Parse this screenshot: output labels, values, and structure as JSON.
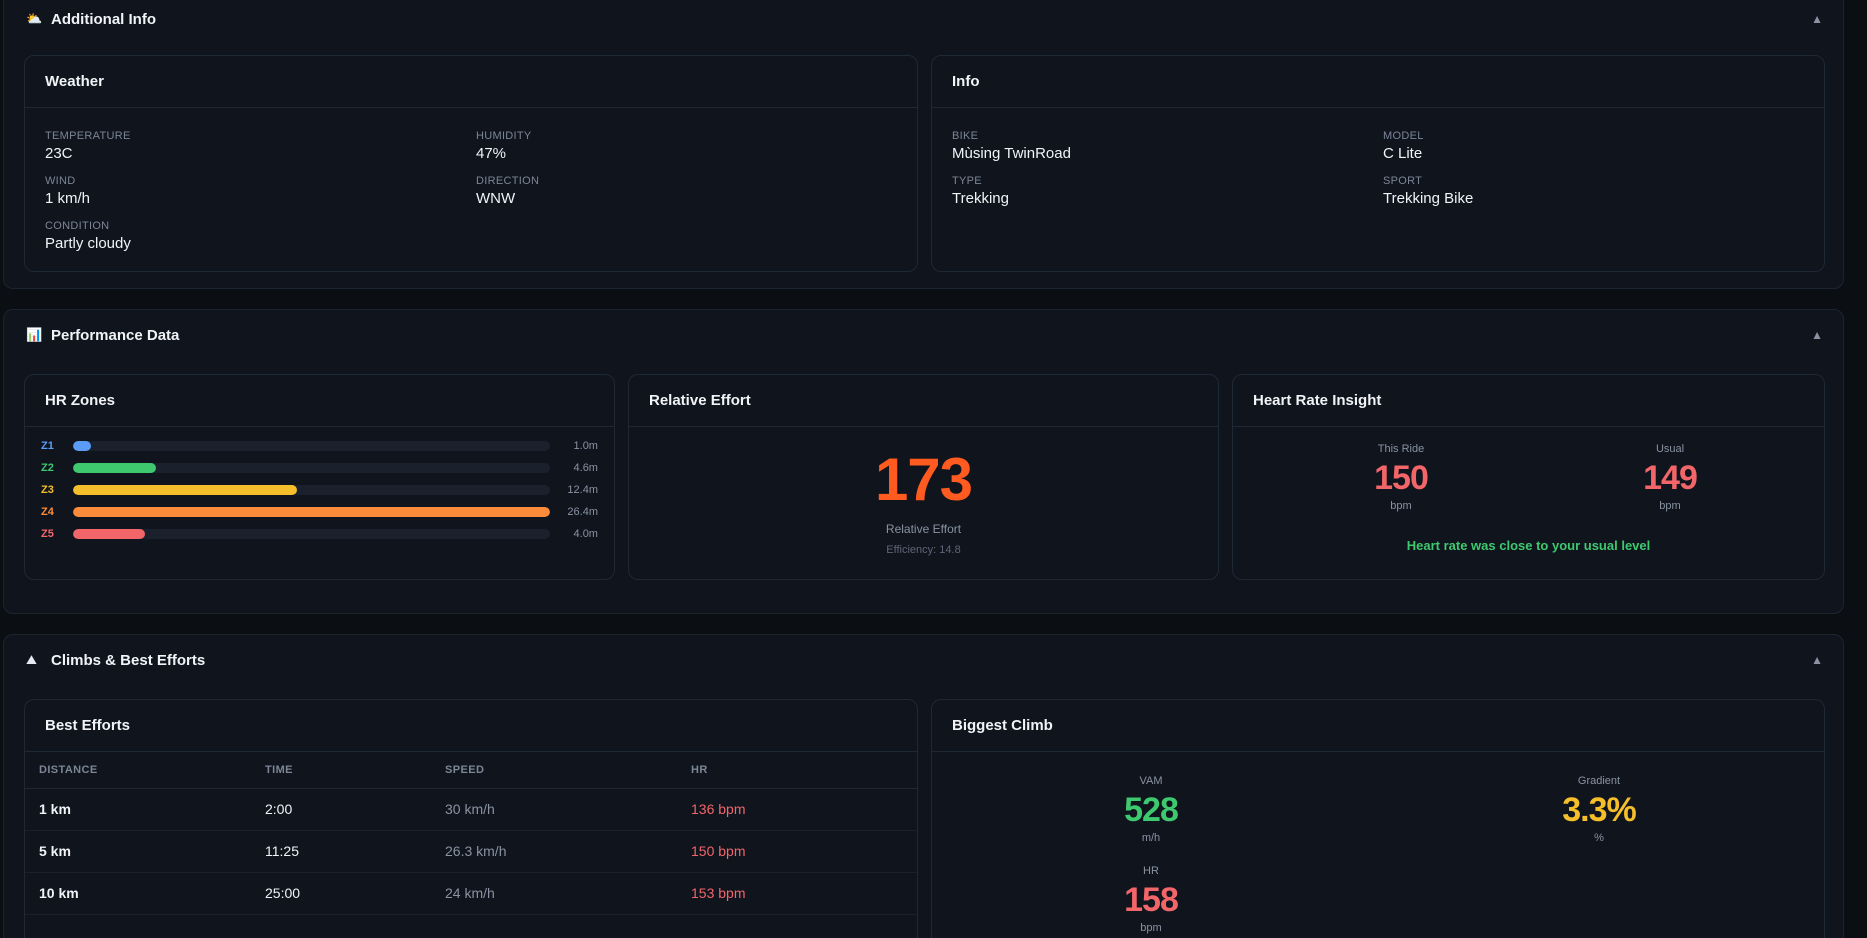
{
  "additional": {
    "title": "Additional Info",
    "toggle": "▲",
    "weather": {
      "title": "Weather",
      "temperature_label": "TEMPERATURE",
      "temperature": "23C",
      "humidity_label": "HUMIDITY",
      "humidity": "47%",
      "wind_label": "WIND",
      "wind": "1 km/h",
      "direction_label": "DIRECTION",
      "direction": "WNW",
      "condition_label": "CONDITION",
      "condition": "Partly cloudy"
    },
    "info": {
      "title": "Info",
      "bike_label": "BIKE",
      "bike": "Mùsing TwinRoad",
      "model_label": "MODEL",
      "model": "C Lite",
      "type_label": "TYPE",
      "type": "Trekking",
      "sport_label": "SPORT",
      "sport": "Trekking Bike"
    }
  },
  "performance": {
    "title": "Performance Data",
    "toggle": "▲",
    "hr_zones": {
      "title": "HR Zones",
      "zones": [
        {
          "label": "Z1",
          "value": "1.0m",
          "fraction": 0.038,
          "color": "#5b9cf6"
        },
        {
          "label": "Z2",
          "value": "4.6m",
          "fraction": 0.174,
          "color": "#3ec96f"
        },
        {
          "label": "Z3",
          "value": "12.4m",
          "fraction": 0.47,
          "color": "#f5be2b"
        },
        {
          "label": "Z4",
          "value": "26.4m",
          "fraction": 1.0,
          "color": "#fb8c3c"
        },
        {
          "label": "Z5",
          "value": "4.0m",
          "fraction": 0.152,
          "color": "#f2666a"
        }
      ]
    },
    "relative_effort": {
      "title": "Relative Effort",
      "value": "173",
      "label": "Relative Effort",
      "efficiency": "Efficiency: 14.8"
    },
    "hr_insight": {
      "title": "Heart Rate Insight",
      "this_label": "This Ride",
      "this_value": "150",
      "this_unit": "bpm",
      "usual_label": "Usual",
      "usual_value": "149",
      "usual_unit": "bpm",
      "message": "Heart rate was close to your usual level"
    }
  },
  "climbs": {
    "title": "Climbs & Best Efforts",
    "toggle": "▲",
    "best_efforts": {
      "title": "Best Efforts",
      "headers": [
        "DISTANCE",
        "TIME",
        "SPEED",
        "HR"
      ],
      "rows": [
        {
          "distance": "1 km",
          "time": "2:00",
          "speed": "30 km/h",
          "hr": "136 bpm"
        },
        {
          "distance": "5 km",
          "time": "11:25",
          "speed": "26.3 km/h",
          "hr": "150 bpm"
        },
        {
          "distance": "10 km",
          "time": "25:00",
          "speed": "24 km/h",
          "hr": "153 bpm"
        }
      ]
    },
    "biggest_climb": {
      "title": "Biggest Climb",
      "vam_label": "VAM",
      "vam": "528",
      "vam_unit": "m/h",
      "gradient_label": "Gradient",
      "gradient": "3.3%",
      "gradient_unit": "%",
      "hr_label": "HR",
      "hr": "158",
      "hr_unit": "bpm"
    }
  }
}
